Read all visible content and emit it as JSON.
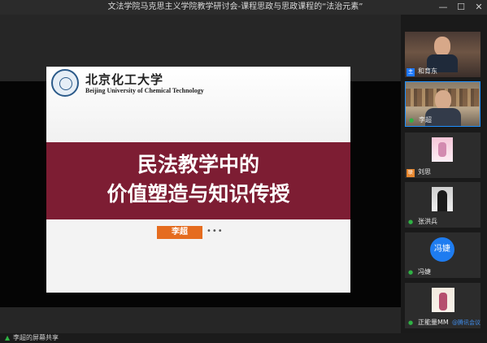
{
  "window": {
    "title": "文法学院马克思主义学院教学研讨会-课程思政与思政课程的“法治元素”",
    "controls": {
      "minimize": "—",
      "maximize": "☐",
      "close": "✕"
    }
  },
  "slide": {
    "university_cn": "北京化工大学",
    "university_en": "Beijing University of Chemical Technology",
    "title_line1": "民法教学中的",
    "title_line2": "价值塑造与知识传授",
    "presenter": "李超",
    "more": "•••"
  },
  "status": {
    "share_text": "李超的屏幕共享"
  },
  "participants": [
    {
      "name": "和育东",
      "badge": "host"
    },
    {
      "name": "李超",
      "badge": "speaking"
    },
    {
      "name": "刘思",
      "badge": "host-orange"
    },
    {
      "name": "张洪兵",
      "badge": "mic"
    },
    {
      "name": "冯婕",
      "badge": "mic",
      "avatar_text": "冯婕"
    },
    {
      "name": "正能量MM",
      "badge": "mic",
      "suffix": "@腾讯会议"
    }
  ],
  "colors": {
    "slide_band": "#7d1d33",
    "presenter_tag": "#e56c1f",
    "accent_blue": "#1e7cf0",
    "mic_green": "#2fb344"
  }
}
